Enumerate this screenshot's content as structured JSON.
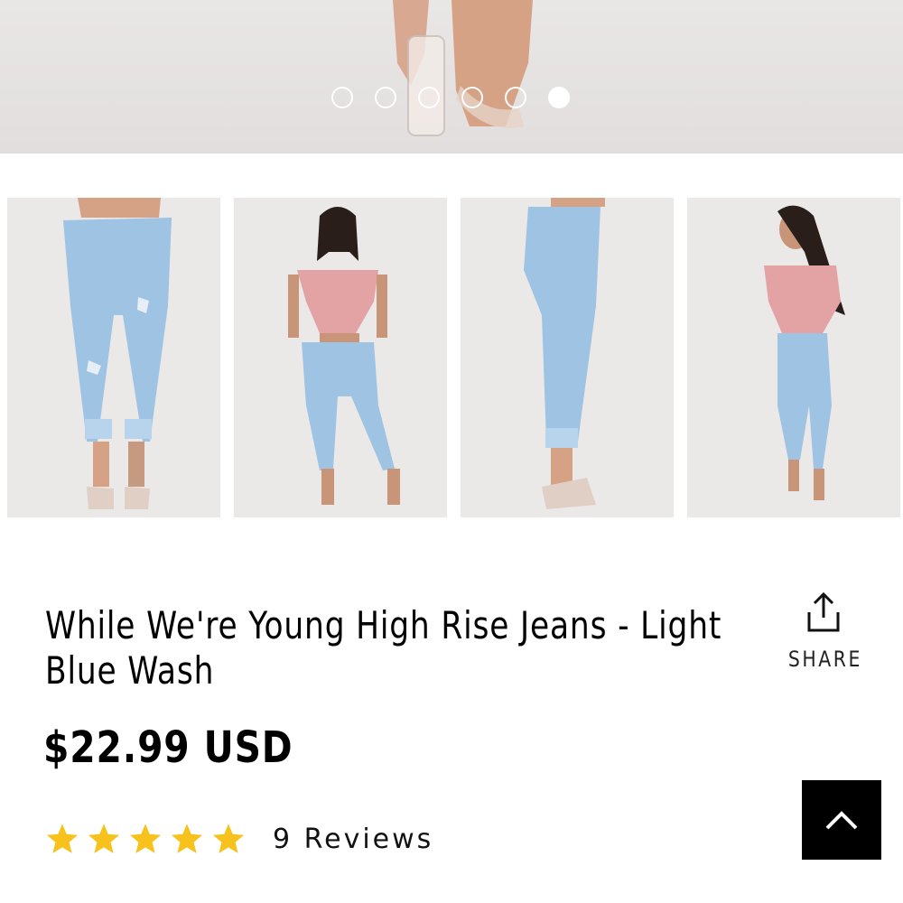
{
  "carousel": {
    "slide_count": 6,
    "active_index": 5
  },
  "thumbnails": [
    {
      "name": "front-closeup"
    },
    {
      "name": "front-full"
    },
    {
      "name": "side-closeup"
    },
    {
      "name": "side-full"
    }
  ],
  "product": {
    "title": "While We're Young High Rise Jeans - Light Blue Wash",
    "price": "$22.99 USD",
    "rating": 5,
    "reviews_label": "9 Reviews"
  },
  "share": {
    "label": "SHARE",
    "icon": "share-icon"
  },
  "back_to_top": {
    "icon": "chevron-up-icon"
  },
  "colors": {
    "star": "#f7c21b",
    "denim": "#9ec3e3",
    "top": "#e3a2a4",
    "button_bg": "#000000"
  }
}
